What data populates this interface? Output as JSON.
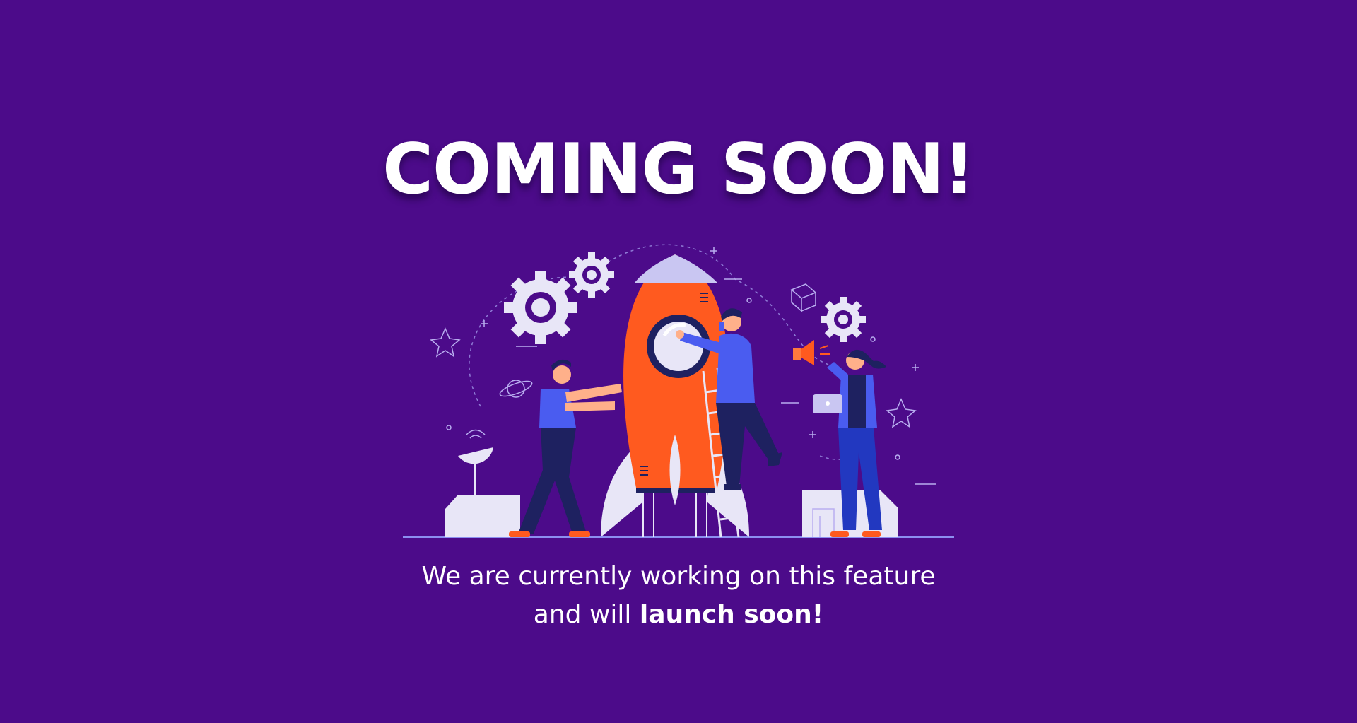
{
  "page": {
    "title": "COMING SOON!",
    "message_line1": "We are currently working on this feature",
    "message_line2_prefix": "and will ",
    "message_line2_emphasis": "launch soon!"
  },
  "colors": {
    "background": "#4c0b8a",
    "text": "#ffffff",
    "rocket": "#ff5a1f",
    "accent_blue": "#4a5cf0",
    "navy": "#1e2160",
    "light": "#e8e6f7"
  },
  "illustration": {
    "icon": "rocket-launch-team-illustration"
  }
}
